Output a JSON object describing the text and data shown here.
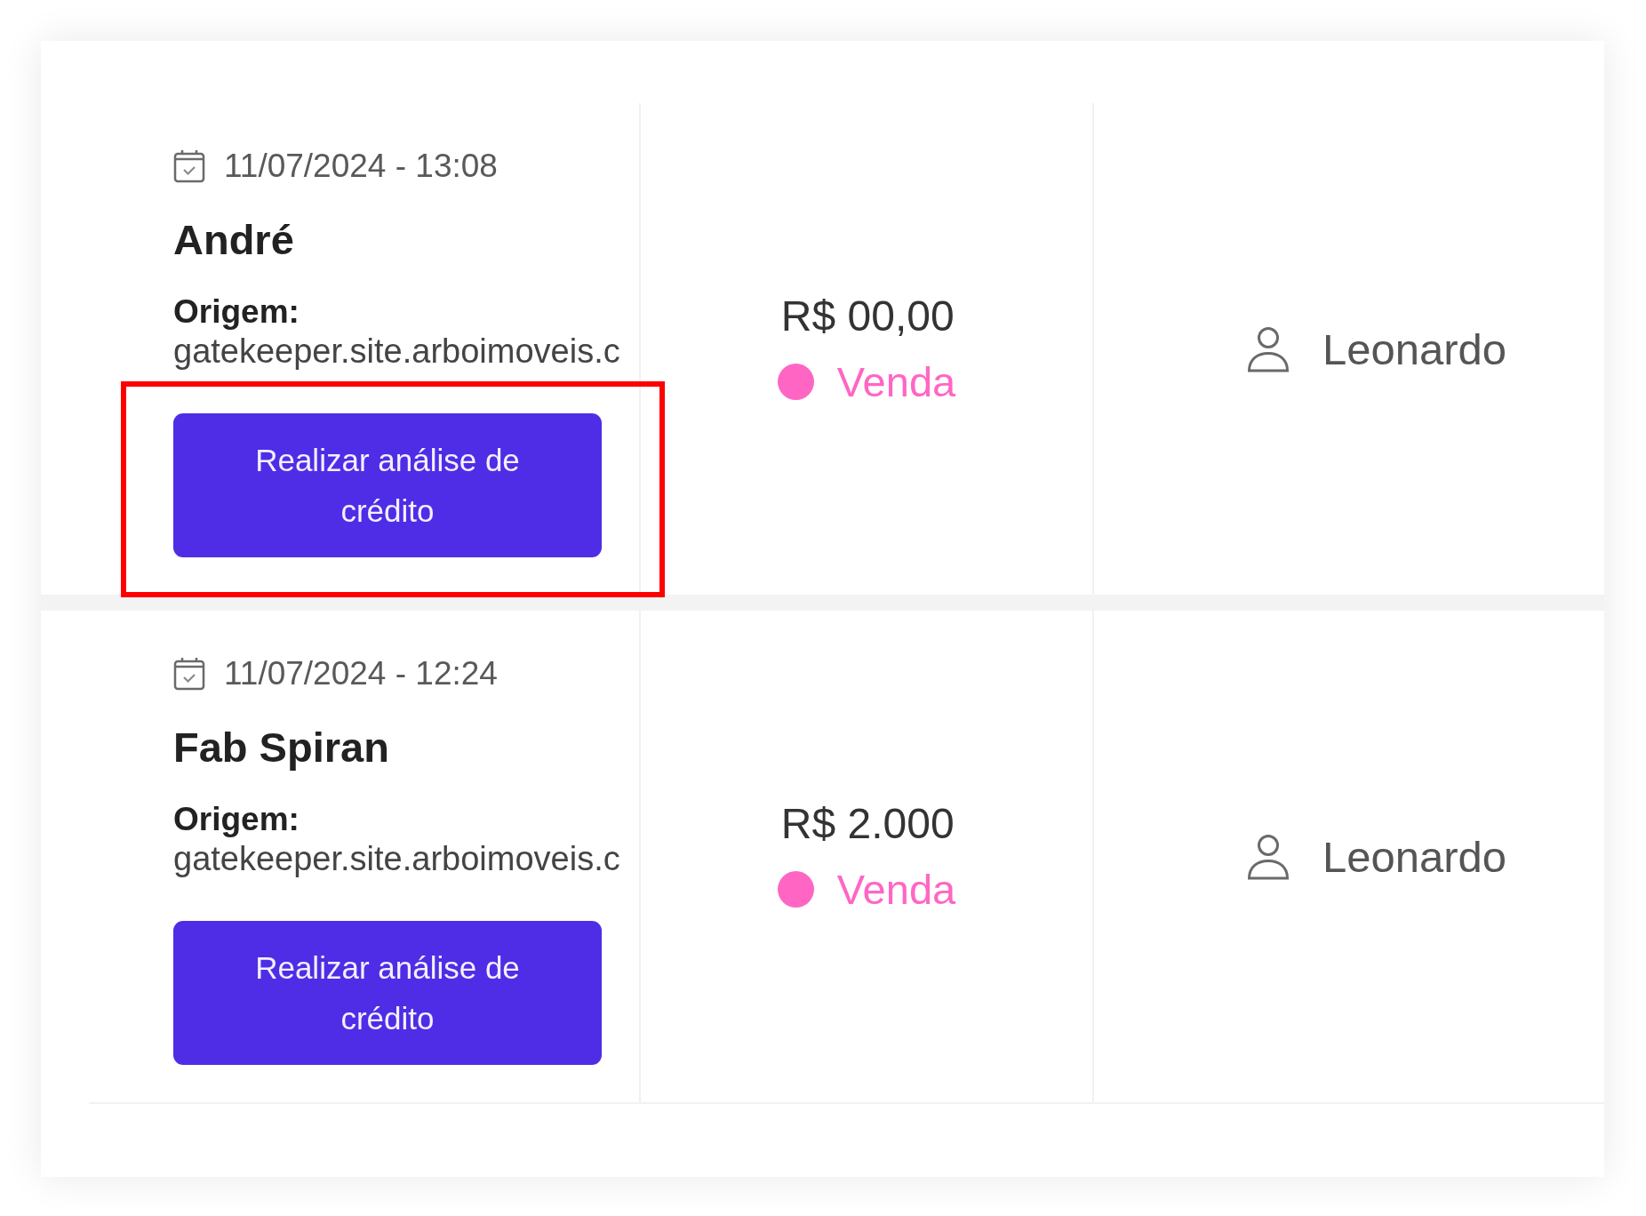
{
  "rows": [
    {
      "date": "11/07/2024 - 13:08",
      "name": "André",
      "origin_label": "Origem:",
      "origin": "gatekeeper.site.arboimoveis.c",
      "action": "Realizar análise de crédito",
      "highlighted": true,
      "amount": "R$ 00,00",
      "deal_type": {
        "label": "Venda",
        "color": "#ff66c4"
      },
      "agent": "Leonardo"
    },
    {
      "date": "11/07/2024 - 12:24",
      "name": "Fab Spiran",
      "origin_label": "Origem:",
      "origin": "gatekeeper.site.arboimoveis.c",
      "action": "Realizar análise de crédito",
      "highlighted": false,
      "amount": "R$ 2.000",
      "deal_type": {
        "label": "Venda",
        "color": "#ff66c4"
      },
      "agent": "Leonardo"
    }
  ]
}
